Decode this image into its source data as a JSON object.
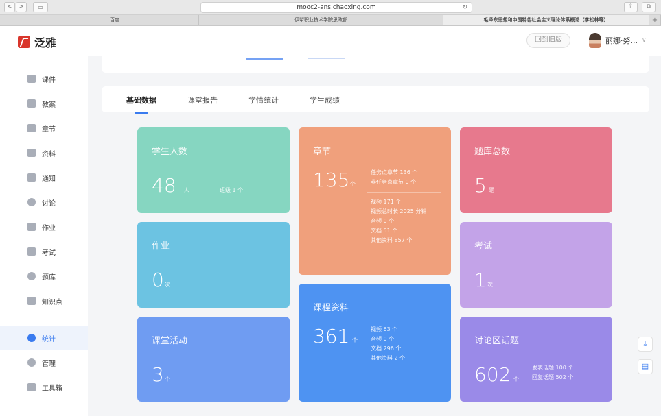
{
  "browser": {
    "nav_back": "<",
    "nav_forward": ">",
    "sidebar_toggle": "▭",
    "url": "mooc2-ans.chaoxing.com",
    "reload": "↻",
    "share": "⇪",
    "tabs_btn": "⧉",
    "tabs": [
      "百度",
      "伊犁职业技术学院思政部",
      "毛泽东思想和中国特色社会主义理论体系概论（李松林等）",
      "+"
    ]
  },
  "header": {
    "logo_text": "泛雅",
    "old_version": "回到旧版",
    "user_name": "丽娜·努...",
    "chevron": "∨"
  },
  "sidebar": {
    "items": [
      {
        "label": "课件"
      },
      {
        "label": "教案"
      },
      {
        "label": "章节"
      },
      {
        "label": "资料"
      },
      {
        "label": "通知"
      },
      {
        "label": "讨论"
      },
      {
        "label": "作业"
      },
      {
        "label": "考试"
      },
      {
        "label": "题库"
      },
      {
        "label": "知识点"
      },
      {
        "label": "统计"
      },
      {
        "label": "管理"
      },
      {
        "label": "工具箱"
      }
    ]
  },
  "main_tabs": [
    "基础数据",
    "课堂报告",
    "学情统计",
    "学生成绩"
  ],
  "cards": {
    "students": {
      "title": "学生人数",
      "value": "48",
      "unit": "人",
      "extra": "班级 1 个"
    },
    "chapters": {
      "title": "章节",
      "value": "135",
      "unit": "个",
      "details_a": [
        "任务点章节 136 个",
        "非任务点章节 0 个"
      ],
      "details_b": [
        "视频 171 个",
        "视频总时长 2025 分钟",
        "音频 0 个",
        "文档 51 个",
        "其他资料 857 个"
      ]
    },
    "bank": {
      "title": "题库总数",
      "value": "5",
      "unit": "题"
    },
    "homework": {
      "title": "作业",
      "value": "0",
      "unit": "次"
    },
    "exam": {
      "title": "考试",
      "value": "1",
      "unit": "次"
    },
    "materials": {
      "title": "课程资料",
      "value": "361",
      "unit": "个",
      "details": [
        "视频 63 个",
        "音频 0 个",
        "文档 296 个",
        "其他资料 2 个"
      ]
    },
    "activity": {
      "title": "课堂活动",
      "value": "3",
      "unit": "个"
    },
    "forum": {
      "title": "讨论区话题",
      "value": "602",
      "unit": "个",
      "details": [
        "发表话题 100 个",
        "回复话题 502 个"
      ]
    }
  },
  "colors": {
    "students": "#86d6c1",
    "chapters": "#f0a07c",
    "bank": "#e7798d",
    "homework": "#6cc3e2",
    "exam": "#c3a3e8",
    "materials": "#4e93f2",
    "activity": "#6f9cf2",
    "forum": "#9a8ae8",
    "accent": "#3a7bef"
  },
  "float_buttons": [
    "⤓",
    "▤"
  ]
}
